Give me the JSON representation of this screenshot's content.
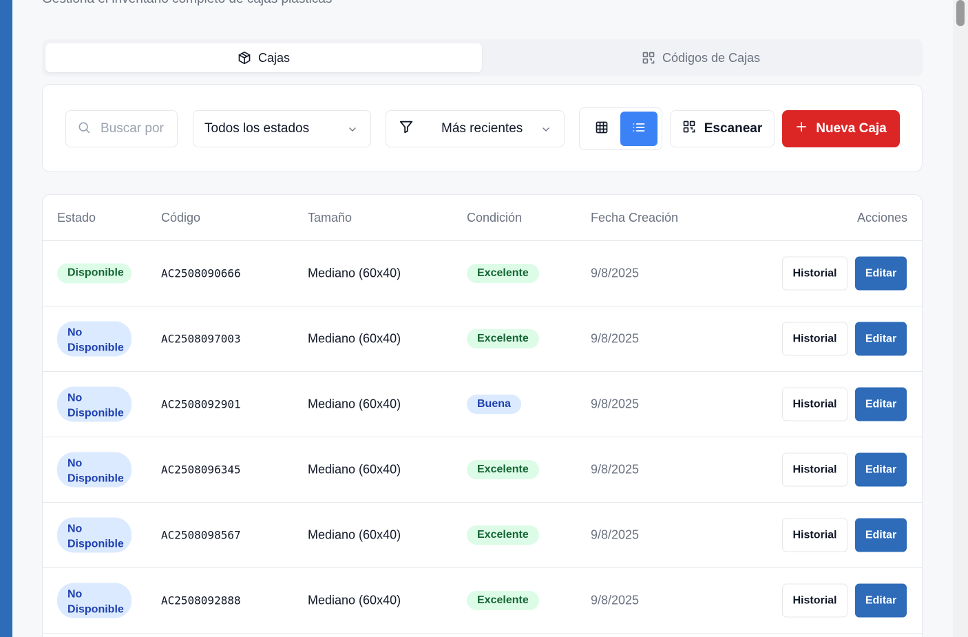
{
  "page": {
    "subtitle": "Gestiona el inventario completo de cajas plásticas"
  },
  "tabs": [
    {
      "label": "Cajas",
      "icon": "box-icon",
      "active": true
    },
    {
      "label": "Códigos de Cajas",
      "icon": "qr-code-icon",
      "active": false
    }
  ],
  "toolbar": {
    "search_placeholder": "Buscar por",
    "status_filter": "Todos los estados",
    "sort": "Más recientes",
    "view_mode": "list",
    "scan_label": "Escanear",
    "new_label": "Nueva Caja",
    "accent_color": "#dc2626",
    "active_view_color": "#3b82f6"
  },
  "table": {
    "headers": {
      "estado": "Estado",
      "codigo": "Código",
      "tamano": "Tamaño",
      "condicion": "Condición",
      "fecha": "Fecha Creación",
      "acciones": "Acciones"
    },
    "history_label": "Historial",
    "edit_label": "Editar",
    "rows": [
      {
        "estado": "Disponible",
        "codigo": "AC2508090666",
        "tamano": "Mediano (60x40)",
        "condicion": "Excelente",
        "fecha": "9/8/2025"
      },
      {
        "estado": "No Disponible",
        "codigo": "AC2508097003",
        "tamano": "Mediano (60x40)",
        "condicion": "Excelente",
        "fecha": "9/8/2025"
      },
      {
        "estado": "No Disponible",
        "codigo": "AC2508092901",
        "tamano": "Mediano (60x40)",
        "condicion": "Buena",
        "fecha": "9/8/2025"
      },
      {
        "estado": "No Disponible",
        "codigo": "AC2508096345",
        "tamano": "Mediano (60x40)",
        "condicion": "Excelente",
        "fecha": "9/8/2025"
      },
      {
        "estado": "No Disponible",
        "codigo": "AC2508098567",
        "tamano": "Mediano (60x40)",
        "condicion": "Excelente",
        "fecha": "9/8/2025"
      },
      {
        "estado": "No Disponible",
        "codigo": "AC2508092888",
        "tamano": "Mediano (60x40)",
        "condicion": "Excelente",
        "fecha": "9/8/2025"
      }
    ]
  }
}
